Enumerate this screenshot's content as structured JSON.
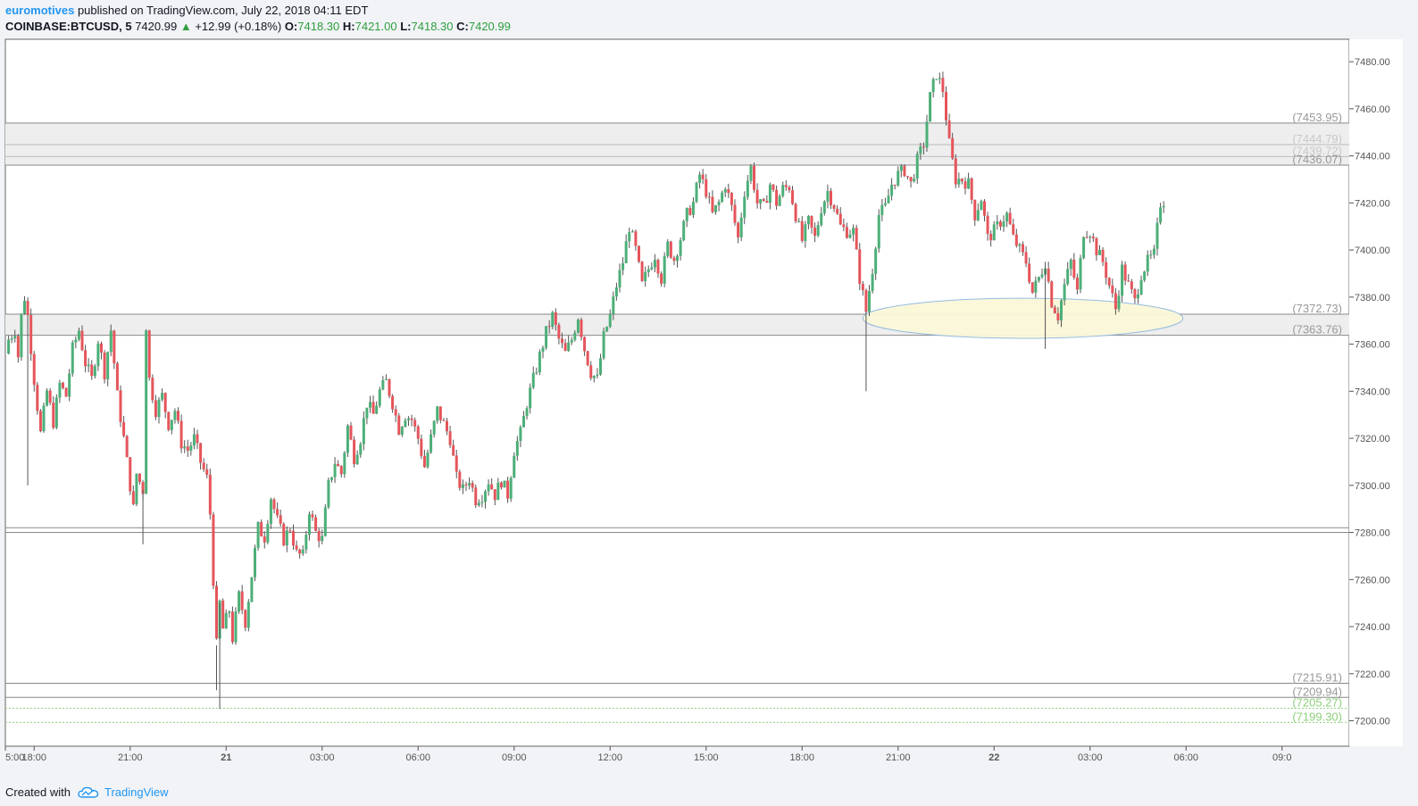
{
  "header": {
    "author": "euromotives",
    "published_text": "published on TradingView.com, July 22, 2018 04:11 EDT",
    "symbol": "COINBASE:BTCUSD, 5",
    "last_price": "7420.99",
    "change_icon": "triangle-up-icon",
    "change": "+12.99 (+0.18%)",
    "o_label": "O:",
    "o_value": "7418.30",
    "h_label": "H:",
    "h_value": "7421.00",
    "l_label": "L:",
    "l_value": "7418.30",
    "c_label": "C:",
    "c_value": "7420.99"
  },
  "footer": {
    "created_with": "Created with",
    "brand": "TradingView",
    "brand_icon": "tradingview-cloud-icon"
  },
  "colors": {
    "up": "#4caf78",
    "down": "#e5555b",
    "brand": "#2196f3",
    "level_line": "#777777",
    "band_fill": "#eeeeee",
    "ellipse_fill": "#fbf8d9",
    "ellipse_stroke": "#8fb8e0"
  },
  "chart_data": {
    "type": "candlestick",
    "title": "COINBASE:BTCUSD, 5",
    "xlabel": "",
    "ylabel": "",
    "ylim": [
      7192,
      7490
    ],
    "y_ticks": [
      7480,
      7460,
      7440,
      7420,
      7400,
      7380,
      7360,
      7340,
      7320,
      7300,
      7280,
      7260,
      7240,
      7220,
      7200
    ],
    "x_range_hours": [
      -6.9,
      35.1
    ],
    "x_ticks": [
      {
        "label": "5:00",
        "h": -6.9
      },
      {
        "label": "18:00",
        "h": -6
      },
      {
        "label": "21:00",
        "h": -3
      },
      {
        "label": "21",
        "h": 0,
        "bold": true
      },
      {
        "label": "03:00",
        "h": 3
      },
      {
        "label": "06:00",
        "h": 6
      },
      {
        "label": "09:00",
        "h": 9
      },
      {
        "label": "12:00",
        "h": 12
      },
      {
        "label": "15:00",
        "h": 15
      },
      {
        "label": "18:00",
        "h": 18
      },
      {
        "label": "21:00",
        "h": 21
      },
      {
        "label": "22",
        "h": 24,
        "bold": true
      },
      {
        "label": "03:00",
        "h": 27
      },
      {
        "label": "06:00",
        "h": 30
      },
      {
        "label": "09:0",
        "h": 33
      }
    ],
    "grid": false,
    "horizontal_levels": [
      {
        "value": 7453.95,
        "label": "(7453.95)",
        "style": "solid",
        "color": "#888888"
      },
      {
        "value": 7444.79,
        "label": "(7444.79)",
        "style": "solid",
        "color": "#bbbbbb"
      },
      {
        "value": 7439.72,
        "label": "(7439.72)",
        "style": "solid",
        "color": "#bbbbbb"
      },
      {
        "value": 7436.07,
        "label": "(7436.07)",
        "style": "solid",
        "color": "#888888"
      },
      {
        "value": 7372.73,
        "label": "(7372.73)",
        "style": "solid",
        "color": "#888888"
      },
      {
        "value": 7363.76,
        "label": "(7363.76)",
        "style": "solid",
        "color": "#888888"
      },
      {
        "value": 7282,
        "label": "",
        "style": "solid",
        "color": "#888888"
      },
      {
        "value": 7280,
        "label": "",
        "style": "solid",
        "color": "#888888"
      },
      {
        "value": 7215.91,
        "label": "(7215.91)",
        "style": "solid",
        "color": "#888888"
      },
      {
        "value": 7209.94,
        "label": "(7209.94)",
        "style": "solid",
        "color": "#888888"
      },
      {
        "value": 7205.27,
        "label": "(7205.27)",
        "style": "dotted",
        "color": "#8ccf7a"
      },
      {
        "value": 7199.3,
        "label": "(7199.30)",
        "style": "dotted",
        "color": "#8ccf7a"
      }
    ],
    "bands": [
      {
        "from": 7436.07,
        "to": 7453.95
      },
      {
        "from": 7363.76,
        "to": 7372.73
      }
    ],
    "ellipse": {
      "h_from": 19.9,
      "h_to": 29.9,
      "v_center": 7371,
      "v_radius": 8.5
    },
    "close_path": [
      [
        -6.9,
        7356
      ],
      [
        -6.8,
        7362
      ],
      [
        -6.6,
        7366
      ],
      [
        -6.5,
        7355
      ],
      [
        -6.4,
        7372
      ],
      [
        -6.3,
        7380
      ],
      [
        -6.2,
        7372
      ],
      [
        -6.0,
        7345
      ],
      [
        -5.8,
        7322
      ],
      [
        -5.6,
        7340
      ],
      [
        -5.4,
        7327
      ],
      [
        -5.2,
        7343
      ],
      [
        -5.0,
        7338
      ],
      [
        -4.8,
        7358
      ],
      [
        -4.6,
        7366
      ],
      [
        -4.4,
        7352
      ],
      [
        -4.2,
        7345
      ],
      [
        -4.0,
        7362
      ],
      [
        -3.8,
        7348
      ],
      [
        -3.6,
        7366
      ],
      [
        -3.4,
        7338
      ],
      [
        -3.2,
        7320
      ],
      [
        -3.0,
        7300
      ],
      [
        -2.9,
        7290
      ],
      [
        -2.8,
        7305
      ],
      [
        -2.6,
        7298
      ],
      [
        -2.5,
        7368
      ],
      [
        -2.4,
        7345
      ],
      [
        -2.2,
        7332
      ],
      [
        -2.0,
        7338
      ],
      [
        -1.8,
        7326
      ],
      [
        -1.6,
        7332
      ],
      [
        -1.4,
        7318
      ],
      [
        -1.2,
        7315
      ],
      [
        -1.0,
        7320
      ],
      [
        -0.8,
        7310
      ],
      [
        -0.6,
        7303
      ],
      [
        -0.5,
        7288
      ],
      [
        -0.4,
        7260
      ],
      [
        -0.3,
        7232
      ],
      [
        -0.2,
        7250
      ],
      [
        -0.1,
        7239
      ],
      [
        0.1,
        7247
      ],
      [
        0.2,
        7235
      ],
      [
        0.4,
        7253
      ],
      [
        0.6,
        7242
      ],
      [
        0.8,
        7262
      ],
      [
        1.0,
        7282
      ],
      [
        1.2,
        7278
      ],
      [
        1.4,
        7295
      ],
      [
        1.6,
        7285
      ],
      [
        1.8,
        7277
      ],
      [
        2.0,
        7282
      ],
      [
        2.2,
        7271
      ],
      [
        2.4,
        7270
      ],
      [
        2.6,
        7290
      ],
      [
        2.8,
        7280
      ],
      [
        3.0,
        7277
      ],
      [
        3.2,
        7300
      ],
      [
        3.4,
        7310
      ],
      [
        3.6,
        7305
      ],
      [
        3.8,
        7325
      ],
      [
        4.0,
        7312
      ],
      [
        4.2,
        7320
      ],
      [
        4.4,
        7335
      ],
      [
        4.6,
        7330
      ],
      [
        4.8,
        7340
      ],
      [
        5.0,
        7344
      ],
      [
        5.2,
        7335
      ],
      [
        5.4,
        7324
      ],
      [
        5.6,
        7330
      ],
      [
        5.8,
        7328
      ],
      [
        6.0,
        7320
      ],
      [
        6.2,
        7308
      ],
      [
        6.4,
        7320
      ],
      [
        6.6,
        7332
      ],
      [
        6.8,
        7326
      ],
      [
        7.0,
        7320
      ],
      [
        7.2,
        7303
      ],
      [
        7.4,
        7298
      ],
      [
        7.6,
        7303
      ],
      [
        7.8,
        7294
      ],
      [
        8.0,
        7296
      ],
      [
        8.2,
        7302
      ],
      [
        8.4,
        7296
      ],
      [
        8.6,
        7302
      ],
      [
        8.8,
        7296
      ],
      [
        9.0,
        7315
      ],
      [
        9.2,
        7322
      ],
      [
        9.4,
        7335
      ],
      [
        9.6,
        7345
      ],
      [
        9.8,
        7355
      ],
      [
        10.0,
        7365
      ],
      [
        10.2,
        7372
      ],
      [
        10.4,
        7362
      ],
      [
        10.6,
        7356
      ],
      [
        10.8,
        7362
      ],
      [
        11.0,
        7372
      ],
      [
        11.2,
        7358
      ],
      [
        11.4,
        7348
      ],
      [
        11.6,
        7345
      ],
      [
        11.8,
        7363
      ],
      [
        12.0,
        7372
      ],
      [
        12.2,
        7385
      ],
      [
        12.4,
        7395
      ],
      [
        12.6,
        7410
      ],
      [
        12.8,
        7400
      ],
      [
        13.0,
        7385
      ],
      [
        13.2,
        7392
      ],
      [
        13.4,
        7398
      ],
      [
        13.6,
        7388
      ],
      [
        13.8,
        7402
      ],
      [
        14.0,
        7396
      ],
      [
        14.2,
        7405
      ],
      [
        14.4,
        7415
      ],
      [
        14.6,
        7420
      ],
      [
        14.8,
        7432
      ],
      [
        15.0,
        7425
      ],
      [
        15.2,
        7415
      ],
      [
        15.4,
        7420
      ],
      [
        15.6,
        7428
      ],
      [
        15.8,
        7418
      ],
      [
        16.0,
        7405
      ],
      [
        16.2,
        7425
      ],
      [
        16.4,
        7435
      ],
      [
        16.6,
        7420
      ],
      [
        16.8,
        7418
      ],
      [
        17.0,
        7428
      ],
      [
        17.2,
        7420
      ],
      [
        17.4,
        7426
      ],
      [
        17.6,
        7427
      ],
      [
        17.8,
        7415
      ],
      [
        18.0,
        7404
      ],
      [
        18.2,
        7412
      ],
      [
        18.4,
        7405
      ],
      [
        18.6,
        7418
      ],
      [
        18.8,
        7425
      ],
      [
        19.0,
        7419
      ],
      [
        19.2,
        7410
      ],
      [
        19.4,
        7408
      ],
      [
        19.6,
        7408
      ],
      [
        19.8,
        7388
      ],
      [
        20.0,
        7374
      ],
      [
        20.2,
        7392
      ],
      [
        20.4,
        7415
      ],
      [
        20.6,
        7418
      ],
      [
        20.8,
        7428
      ],
      [
        21.0,
        7432
      ],
      [
        21.2,
        7434
      ],
      [
        21.4,
        7428
      ],
      [
        21.6,
        7438
      ],
      [
        21.8,
        7445
      ],
      [
        22.0,
        7465
      ],
      [
        22.2,
        7475
      ],
      [
        22.4,
        7468
      ],
      [
        22.6,
        7445
      ],
      [
        22.8,
        7430
      ],
      [
        23.0,
        7430
      ],
      [
        23.2,
        7428
      ],
      [
        23.4,
        7415
      ],
      [
        23.6,
        7422
      ],
      [
        23.8,
        7405
      ],
      [
        24.0,
        7408
      ],
      [
        24.2,
        7412
      ],
      [
        24.4,
        7415
      ],
      [
        24.6,
        7405
      ],
      [
        24.8,
        7400
      ],
      [
        25.0,
        7395
      ],
      [
        25.2,
        7382
      ],
      [
        25.4,
        7388
      ],
      [
        25.6,
        7395
      ],
      [
        25.8,
        7378
      ],
      [
        26.0,
        7372
      ],
      [
        26.2,
        7385
      ],
      [
        26.4,
        7395
      ],
      [
        26.6,
        7382
      ],
      [
        26.8,
        7408
      ],
      [
        27.0,
        7408
      ],
      [
        27.2,
        7400
      ],
      [
        27.4,
        7395
      ],
      [
        27.6,
        7385
      ],
      [
        27.8,
        7375
      ],
      [
        28.0,
        7392
      ],
      [
        28.2,
        7385
      ],
      [
        28.4,
        7378
      ],
      [
        28.6,
        7390
      ],
      [
        28.8,
        7395
      ],
      [
        29.0,
        7398
      ],
      [
        29.2,
        7420
      ],
      [
        29.3,
        7421
      ]
    ],
    "big_wicks": [
      {
        "h": -6.2,
        "low": 7300
      },
      {
        "h": -2.6,
        "low": 7275
      },
      {
        "h": -0.3,
        "low": 7213
      },
      {
        "h": -0.2,
        "low": 7205
      },
      {
        "h": 20.0,
        "low": 7340
      },
      {
        "h": 25.6,
        "low": 7358
      }
    ]
  }
}
